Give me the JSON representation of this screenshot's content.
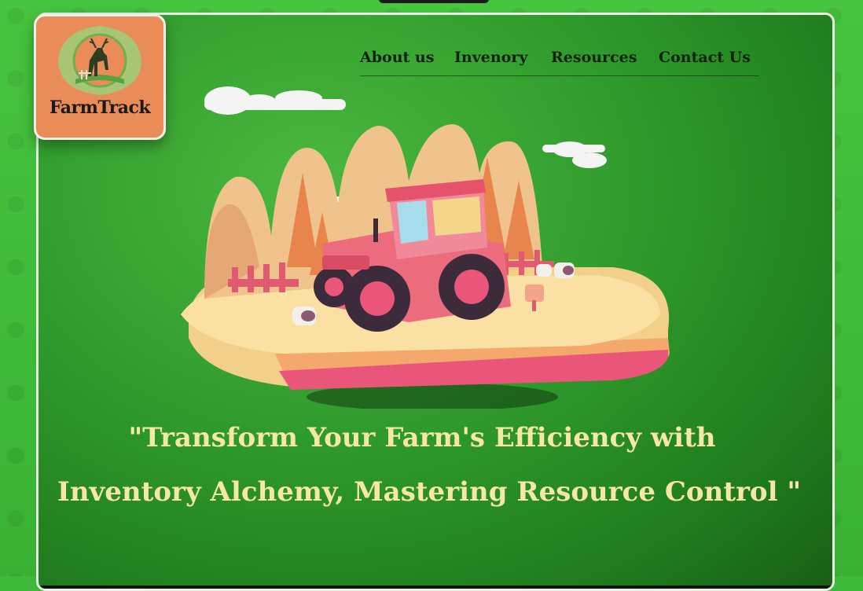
{
  "brand": {
    "name": "FarmTrack",
    "logo_bg": "#e98c58",
    "emblem_icon": "deer-icon"
  },
  "nav": {
    "items": [
      {
        "label": "About us"
      },
      {
        "label": "Invenory"
      },
      {
        "label": "Resources"
      },
      {
        "label": "Contact Us"
      }
    ]
  },
  "hero": {
    "illustration": "tractor-farm-icon",
    "quote_line1": "\"Transform Your Farm's Efficiency with",
    "quote_line2": "Inventory Alchemy, Mastering Resource Control \""
  },
  "colors": {
    "background": "#3fb93a",
    "panel_green": "#2f9a2c",
    "quote_text": "#f6e7a6",
    "nav_text": "#13210f"
  }
}
